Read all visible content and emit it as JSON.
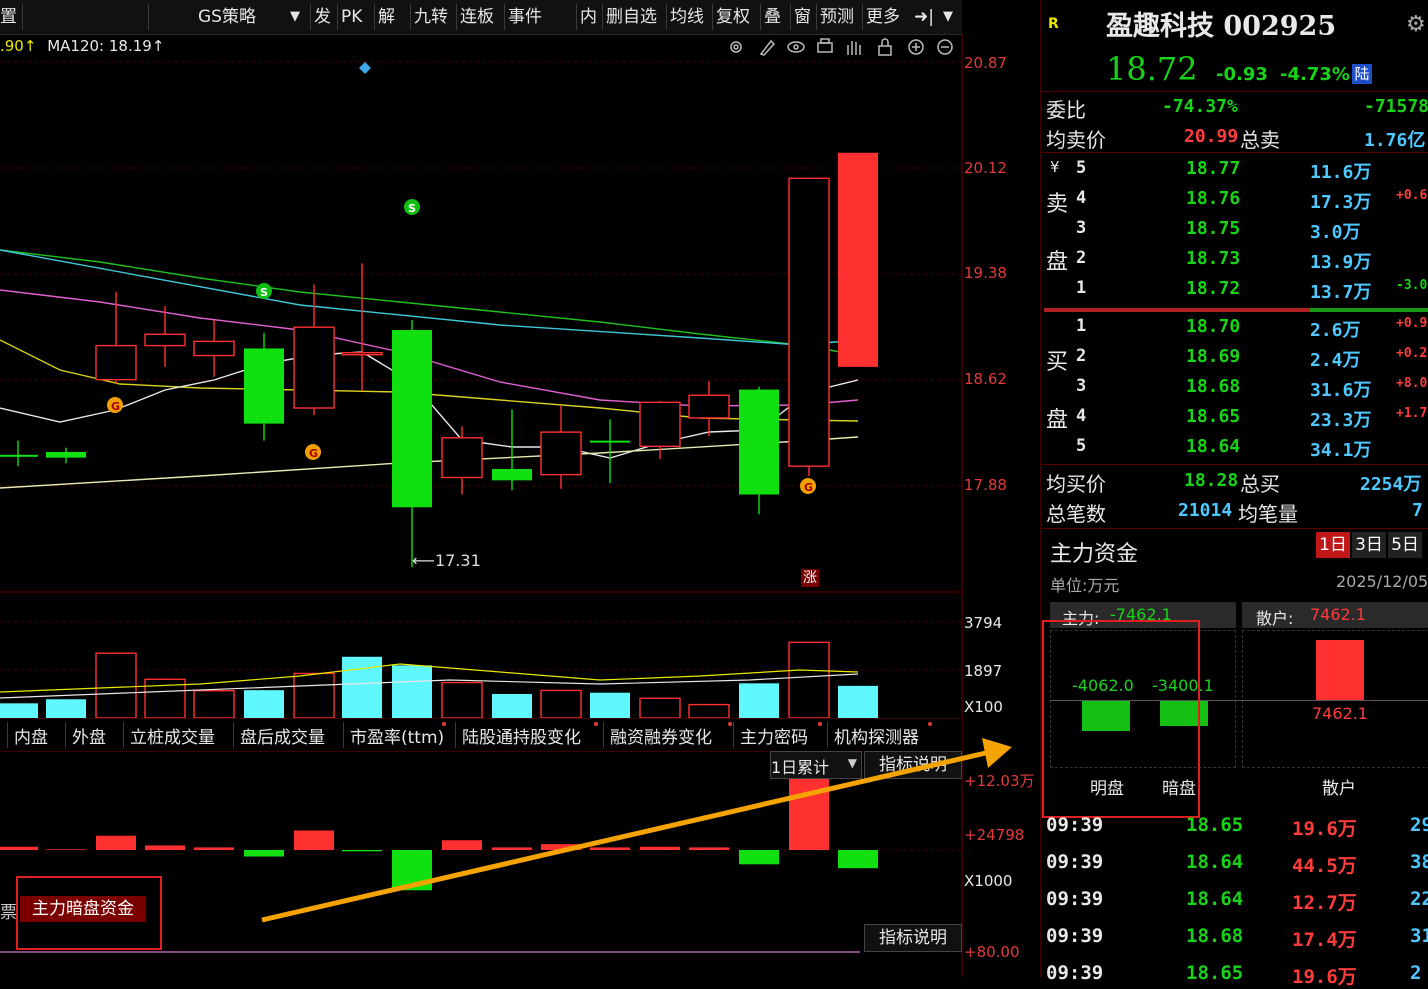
{
  "toolbar": {
    "left_label": "置",
    "strategy_label": "GS策略",
    "items": [
      "发",
      "PK",
      "解",
      "九转",
      "连板",
      "事件",
      "内",
      "删自选",
      "均线",
      "复权",
      "叠",
      "窗",
      "预测",
      "更多"
    ]
  },
  "chart_icons": [
    "settings-icon",
    "pen-icon",
    "eye-icon",
    "print-icon",
    "hand-icon",
    "lock-icon",
    "zoom-in-icon",
    "zoom-out-icon"
  ],
  "ma_legend": {
    "ma60_fragment": ".90↑",
    "ma120": "MA120: 18.19↑"
  },
  "price_axis": [
    "20.87",
    "20.12",
    "19.38",
    "18.62",
    "17.88"
  ],
  "low_marker": "17.31",
  "zhang_marker": "涨",
  "chart_data": {
    "type": "candlestick",
    "candles": [
      {
        "o": 18.1,
        "c": 18.1,
        "h": 18.2,
        "l": 18.02,
        "color": "green"
      },
      {
        "o": 18.12,
        "c": 18.08,
        "h": 18.15,
        "l": 18.04,
        "color": "green"
      },
      {
        "o": 18.63,
        "c": 18.87,
        "h": 19.25,
        "l": 18.6,
        "color": "red"
      },
      {
        "o": 18.87,
        "c": 18.95,
        "h": 19.15,
        "l": 18.72,
        "color": "red"
      },
      {
        "o": 18.8,
        "c": 18.9,
        "h": 19.05,
        "l": 18.65,
        "color": "red"
      },
      {
        "o": 18.85,
        "c": 18.32,
        "h": 18.96,
        "l": 18.2,
        "color": "green"
      },
      {
        "o": 18.43,
        "c": 19.0,
        "h": 19.3,
        "l": 18.38,
        "color": "red"
      },
      {
        "o": 18.82,
        "c": 18.82,
        "h": 19.45,
        "l": 18.55,
        "color": "red"
      },
      {
        "o": 18.98,
        "c": 17.73,
        "h": 19.05,
        "l": 17.31,
        "color": "green"
      },
      {
        "o": 17.94,
        "c": 18.22,
        "h": 18.3,
        "l": 17.82,
        "color": "red"
      },
      {
        "o": 18.0,
        "c": 17.92,
        "h": 18.42,
        "l": 17.85,
        "color": "green"
      },
      {
        "o": 17.96,
        "c": 18.26,
        "h": 18.45,
        "l": 17.86,
        "color": "red"
      },
      {
        "o": 18.2,
        "c": 18.2,
        "h": 18.35,
        "l": 17.9,
        "color": "green"
      },
      {
        "o": 18.16,
        "c": 18.47,
        "h": 18.48,
        "l": 18.07,
        "color": "red"
      },
      {
        "o": 18.36,
        "c": 18.52,
        "h": 18.62,
        "l": 18.23,
        "color": "red"
      },
      {
        "o": 18.56,
        "c": 17.82,
        "h": 18.58,
        "l": 17.68,
        "color": "green"
      },
      {
        "o": 18.02,
        "c": 20.05,
        "h": 20.05,
        "l": 17.95,
        "color": "red"
      },
      {
        "o": 18.72,
        "c": 20.23,
        "h": 20.23,
        "l": 18.72,
        "color": "red"
      }
    ],
    "signal_icons": [
      "S",
      "S",
      "S",
      "G",
      "G",
      "G"
    ],
    "volume_axis": [
      "3794",
      "1897",
      "X100"
    ],
    "volume": [
      {
        "v": 580,
        "color": "cyan"
      },
      {
        "v": 740,
        "color": "cyan"
      },
      {
        "v": 2560,
        "color": "red"
      },
      {
        "v": 1530,
        "color": "red"
      },
      {
        "v": 1080,
        "color": "red"
      },
      {
        "v": 1100,
        "color": "cyan"
      },
      {
        "v": 1760,
        "color": "red"
      },
      {
        "v": 2420,
        "color": "cyan"
      },
      {
        "v": 2080,
        "color": "cyan"
      },
      {
        "v": 1400,
        "color": "red"
      },
      {
        "v": 950,
        "color": "cyan"
      },
      {
        "v": 1090,
        "color": "red"
      },
      {
        "v": 1000,
        "color": "cyan"
      },
      {
        "v": 780,
        "color": "red"
      },
      {
        "v": 530,
        "color": "red"
      },
      {
        "v": 1370,
        "color": "cyan"
      },
      {
        "v": 2990,
        "color": "red"
      },
      {
        "v": 1270,
        "color": "cyan"
      }
    ],
    "money_axis": [
      "+12.03万",
      "+24798",
      "X1000"
    ],
    "money_flow": [
      5,
      1,
      22,
      7,
      4,
      -10,
      30,
      -2,
      -62,
      15,
      4,
      9,
      4,
      5,
      4,
      -22,
      110,
      -28
    ],
    "bottom_axis": [
      "+80.00"
    ]
  },
  "tabs": [
    "内盘",
    "外盘",
    "立桩成交量",
    "盘后成交量",
    "市盈率(ttm)",
    "陆股通持股变化",
    "融资融券变化",
    "主力密码",
    "机构探测器"
  ],
  "indicator": {
    "period_select": "1日累计",
    "explain": "指标说明",
    "active_tag": "主力暗盘资金",
    "left_frag": "票",
    "explain_bottom": "指标说明"
  },
  "stock": {
    "badge": "R",
    "name": "盈趣科技 002925",
    "price": "18.72",
    "change": "-0.93",
    "change_pct": "-4.73%",
    "tag": "陆",
    "weibi_label": "委比",
    "weibi_pct": "-74.37%",
    "weibi_val": "-71578",
    "avg_sell_label": "均卖价",
    "avg_sell": "20.99",
    "total_sell_label": "总卖",
    "total_sell": "1.76亿",
    "sell_char1": "卖",
    "sell_char2": "盘",
    "buy_char1": "买",
    "buy_char2": "盘",
    "yen": "¥",
    "sells": [
      {
        "n": "5",
        "p": "18.77",
        "v": "11.6万",
        "d": ""
      },
      {
        "n": "4",
        "p": "18.76",
        "v": "17.3万",
        "d": "+0.6"
      },
      {
        "n": "3",
        "p": "18.75",
        "v": "3.0万",
        "d": ""
      },
      {
        "n": "2",
        "p": "18.73",
        "v": "13.9万",
        "d": ""
      },
      {
        "n": "1",
        "p": "18.72",
        "v": "13.7万",
        "d": "-3.0"
      }
    ],
    "buys": [
      {
        "n": "1",
        "p": "18.70",
        "v": "2.6万",
        "d": "+0.9"
      },
      {
        "n": "2",
        "p": "18.69",
        "v": "2.4万",
        "d": "+0.2"
      },
      {
        "n": "3",
        "p": "18.68",
        "v": "31.6万",
        "d": "+8.0"
      },
      {
        "n": "4",
        "p": "18.65",
        "v": "23.3万",
        "d": "+1.7"
      },
      {
        "n": "5",
        "p": "18.64",
        "v": "34.1万",
        "d": ""
      }
    ],
    "avg_buy_label": "均买价",
    "avg_buy": "18.28",
    "total_buy_label": "总买",
    "total_buy": "2254万",
    "trades_label": "总笔数",
    "trades": "21014",
    "avg_vol_label": "均笔量",
    "avg_vol": "7"
  },
  "capital": {
    "title": "主力资金",
    "periods": [
      "1日",
      "3日",
      "5日"
    ],
    "unit": "单位:万元",
    "date": "2025/12/05",
    "main_label": "主力:",
    "main_val": "-7462.1",
    "retail_label": "散户:",
    "retail_val": "7462.1",
    "ming_val": "-4062.0",
    "an_val": "-3400.1",
    "retail_bar_val": "7462.1",
    "ming_label": "明盘",
    "an_label": "暗盘",
    "retail_axis_label": "散户"
  },
  "ticks": [
    {
      "t": "09:39",
      "p": "18.65",
      "v": "19.6万",
      "x": "29"
    },
    {
      "t": "09:39",
      "p": "18.64",
      "v": "44.5万",
      "x": "38"
    },
    {
      "t": "09:39",
      "p": "18.64",
      "v": "12.7万",
      "x": "22"
    },
    {
      "t": "09:39",
      "p": "18.68",
      "v": "17.4万",
      "x": "31"
    },
    {
      "t": "09:39",
      "p": "18.65",
      "v": "19.6万",
      "x": "2"
    }
  ],
  "colors": {
    "up": "#ff3b3b",
    "down": "#19d319",
    "highlight_box": "#e02020",
    "arrow": "#f5a300"
  }
}
